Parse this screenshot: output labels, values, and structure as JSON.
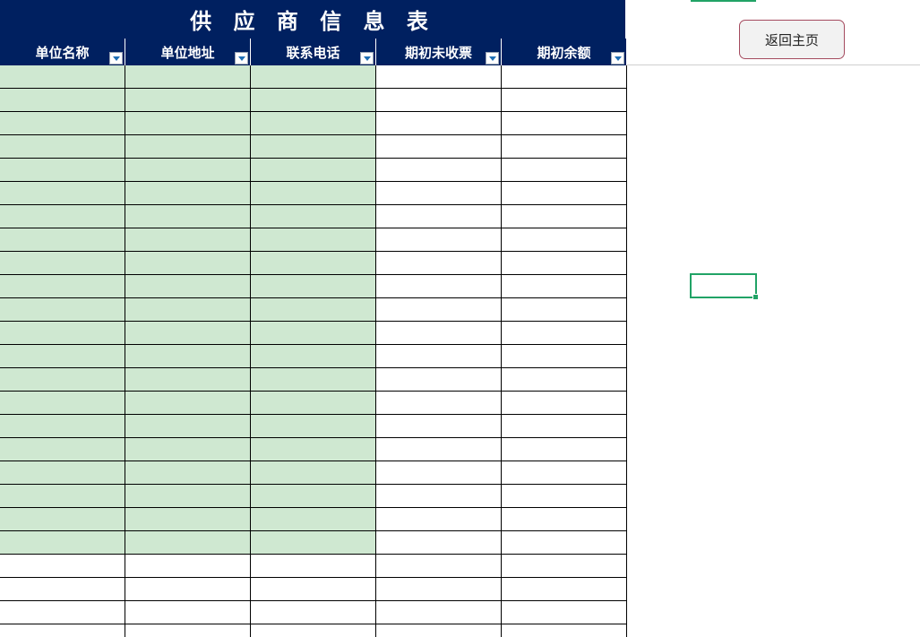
{
  "sheet": {
    "title": "供 应 商 信 息 表",
    "columns": [
      {
        "label": "单位名称"
      },
      {
        "label": "单位地址"
      },
      {
        "label": "联系电话"
      },
      {
        "label": "期初未收票"
      },
      {
        "label": "期初余额"
      }
    ],
    "row_count": 25,
    "green_row_count": 21,
    "green_column_count": 3,
    "colors": {
      "header_bg": "#002060",
      "header_text": "#ffffff",
      "input_cell_bg": "#cfe8d1",
      "selection": "#21a366",
      "button_border": "#a44a5e"
    }
  },
  "actions": {
    "return_home_label": "返回主页"
  },
  "icons": {
    "filter": "filter-dropdown-icon"
  }
}
